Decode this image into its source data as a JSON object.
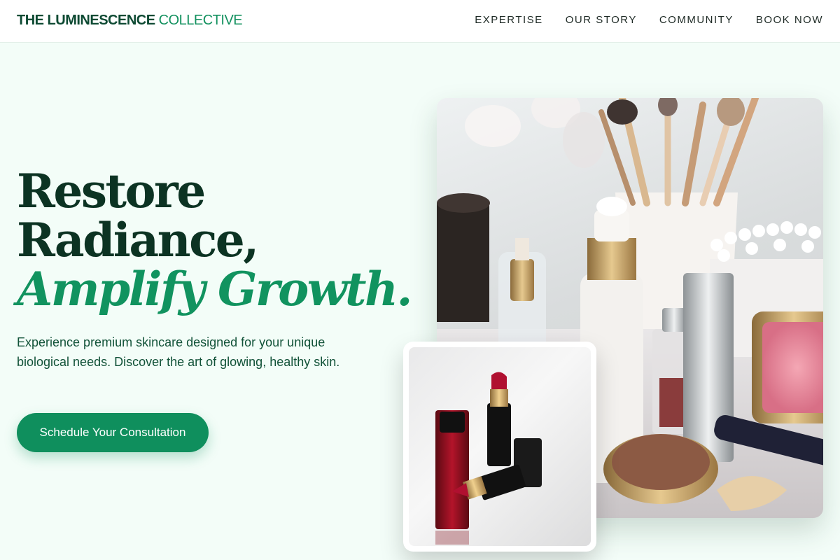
{
  "header": {
    "brand_bold": "THE LUMINESCENCE",
    "brand_light": "COLLECTIVE",
    "nav": [
      {
        "label": "EXPERTISE"
      },
      {
        "label": "OUR STORY"
      },
      {
        "label": "COMMUNITY"
      },
      {
        "label": "BOOK NOW"
      }
    ]
  },
  "hero": {
    "title_line1": "Restore",
    "title_line2": "Radiance,",
    "title_line3": "Amplify Growth.",
    "subtitle": "Experience premium skincare designed for your unique biological needs. Discover the art of glowing, healthy skin.",
    "cta_label": "Schedule Your Consultation"
  },
  "images": {
    "main_alt": "Makeup brushes, serum bottles, cotton swabs and cosmetic compacts on a vanity",
    "inset_alt": "Red lipsticks and nail polish bottles"
  },
  "colors": {
    "brand_dark": "#0e4a33",
    "brand_accent": "#13915f",
    "page_background": "#f3fdf8",
    "cta_background": "#0f8f5d"
  }
}
